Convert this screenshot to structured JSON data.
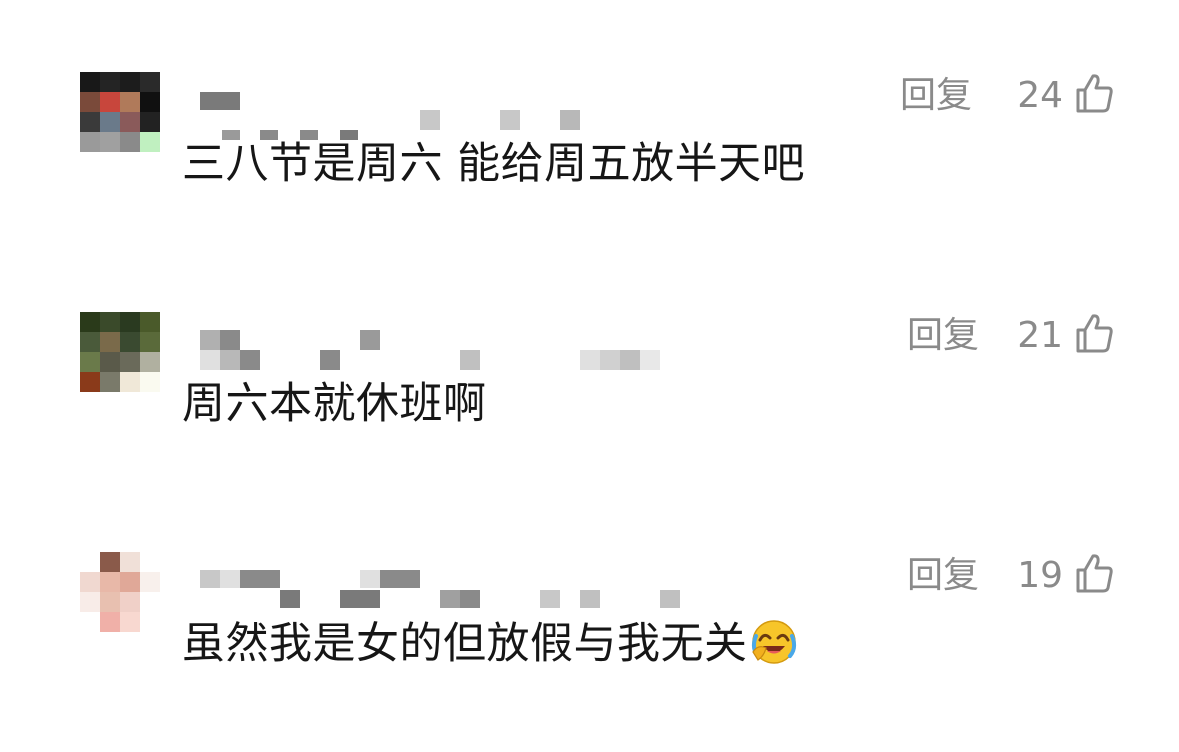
{
  "comments": [
    {
      "reply_label": "回复",
      "likes": "24",
      "text": "三八节是周六 能给周五放半天吧",
      "emoji": "",
      "avatar_colors": [
        "#181818",
        "#242424",
        "#1c1c1c",
        "#2a2a2a",
        "#7a4a3a",
        "#c8463c",
        "#b07a5a",
        "#101010",
        "#3a3a3a",
        "#6a7a8a",
        "#8a5a5a",
        "#222222",
        "#9a9a9a",
        "#a0a0a0",
        "#8a8a8a",
        "#c0f0c0"
      ]
    },
    {
      "reply_label": "回复",
      "likes": "21",
      "text": "周六本就休班啊",
      "emoji": "",
      "avatar_colors": [
        "#2a3a1a",
        "#3a4a2a",
        "#2a3a20",
        "#4a5a2a",
        "#4a5a3a",
        "#7a6a4a",
        "#3a4a30",
        "#5a6a3a",
        "#6a7a4a",
        "#5a5a4a",
        "#6a6a5a",
        "#b0b0a0",
        "#8a3a1a",
        "#7a7a6a",
        "#f0e8d8",
        "#fafaf0"
      ]
    },
    {
      "reply_label": "回复",
      "likes": "19",
      "text": "虽然我是女的但放假与我无关",
      "emoji": "laughing-crying-emoji",
      "avatar_colors": [
        "#ffffff",
        "#8a5a4a",
        "#f0e0d8",
        "#ffffff",
        "#f0d8d0",
        "#e8b8a8",
        "#e0a898",
        "#f8f0ec",
        "#f8ece8",
        "#e8c0b0",
        "#f0d0c8",
        "#ffffff",
        "#ffffff",
        "#f0b0a8",
        "#f8d8d0",
        "#ffffff"
      ]
    }
  ]
}
